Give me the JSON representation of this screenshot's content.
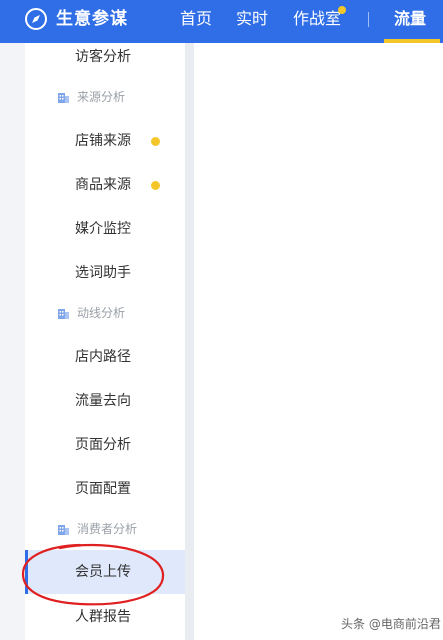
{
  "header": {
    "brand": "生意参谋",
    "logo_icon": "compass-icon",
    "nav": [
      {
        "label": "首页"
      },
      {
        "label": "实时"
      },
      {
        "label": "作战室",
        "badge_dot": true
      },
      {
        "label": "流量",
        "active": true
      }
    ],
    "colors": {
      "background": "#2f6ee6",
      "accent": "#f5c62a"
    }
  },
  "sidebar": {
    "items": [
      {
        "label": "访客分析"
      },
      {
        "group": "来源分析",
        "icon": "building-icon"
      },
      {
        "label": "店铺来源",
        "badge_dot": true
      },
      {
        "label": "商品来源",
        "badge_dot": true
      },
      {
        "label": "媒介监控"
      },
      {
        "label": "选词助手"
      },
      {
        "group": "动线分析",
        "icon": "building-icon"
      },
      {
        "label": "店内路径"
      },
      {
        "label": "流量去向"
      },
      {
        "label": "页面分析"
      },
      {
        "label": "页面配置"
      },
      {
        "group": "消费者分析",
        "icon": "building-icon"
      },
      {
        "label": "会员上传",
        "active": true
      },
      {
        "label": "人群报告"
      }
    ],
    "colors": {
      "active_background": "#dfe9fb",
      "active_bar": "#2f6ee6",
      "badge": "#f5c62a"
    }
  },
  "watermark": "头条 @电商前沿君"
}
